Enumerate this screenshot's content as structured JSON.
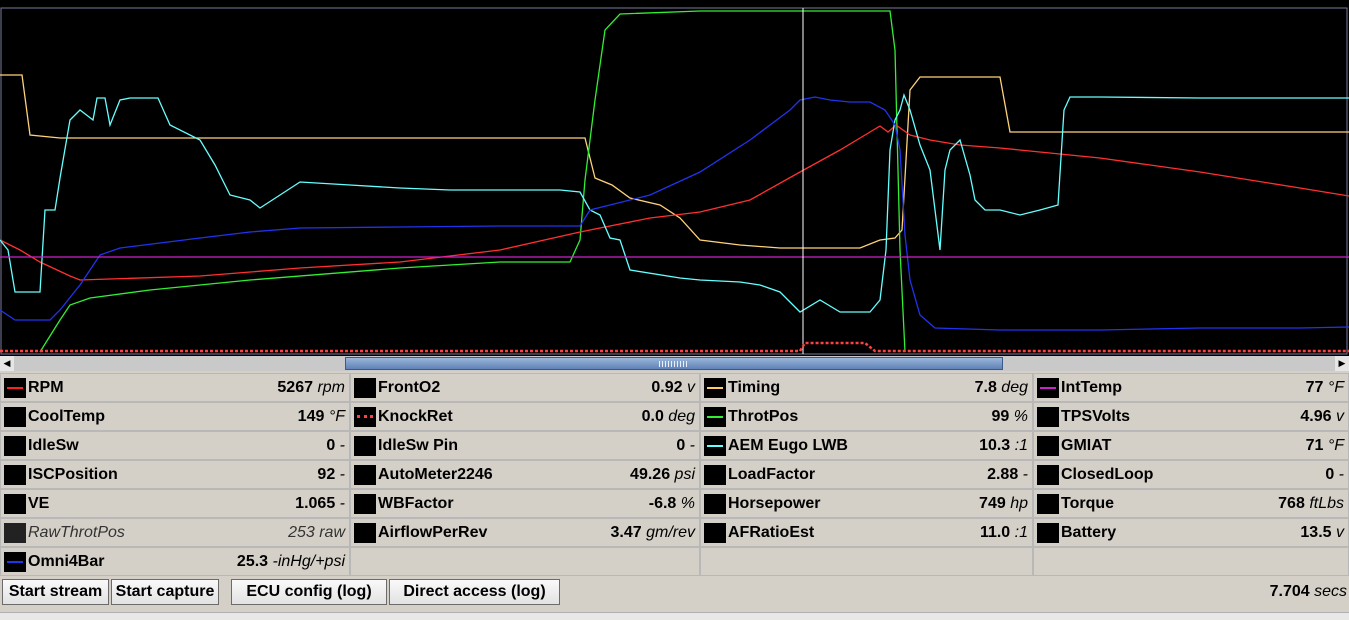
{
  "plot": {
    "series": [
      {
        "name": "Timing",
        "color": "#ffd27a",
        "points": [
          [
            0,
            75
          ],
          [
            22,
            75
          ],
          [
            30,
            135
          ],
          [
            60,
            138
          ],
          [
            100,
            138
          ],
          [
            200,
            138
          ],
          [
            300,
            138
          ],
          [
            400,
            138
          ],
          [
            500,
            138
          ],
          [
            585,
            138
          ],
          [
            595,
            178
          ],
          [
            612,
            185
          ],
          [
            630,
            198
          ],
          [
            660,
            205
          ],
          [
            680,
            218
          ],
          [
            700,
            240
          ],
          [
            740,
            245
          ],
          [
            780,
            248
          ],
          [
            820,
            248
          ],
          [
            860,
            248
          ],
          [
            880,
            240
          ],
          [
            895,
            238
          ],
          [
            902,
            230
          ],
          [
            910,
            90
          ],
          [
            920,
            77
          ],
          [
            1000,
            77
          ],
          [
            1010,
            132
          ],
          [
            1100,
            132
          ],
          [
            1200,
            132
          ],
          [
            1349,
            132
          ]
        ]
      },
      {
        "name": "ThrotPos",
        "color": "#33ee33",
        "points": [
          [
            40,
            352
          ],
          [
            60,
            320
          ],
          [
            70,
            305
          ],
          [
            90,
            298
          ],
          [
            150,
            290
          ],
          [
            250,
            280
          ],
          [
            400,
            268
          ],
          [
            500,
            262
          ],
          [
            570,
            262
          ],
          [
            580,
            240
          ],
          [
            585,
            180
          ],
          [
            595,
            100
          ],
          [
            605,
            30
          ],
          [
            620,
            14
          ],
          [
            700,
            11
          ],
          [
            800,
            11
          ],
          [
            890,
            11
          ],
          [
            895,
            50
          ],
          [
            900,
            250
          ],
          [
            905,
            352
          ]
        ]
      },
      {
        "name": "RPM",
        "color": "#ff3030",
        "points": [
          [
            0,
            240
          ],
          [
            20,
            250
          ],
          [
            40,
            262
          ],
          [
            70,
            276
          ],
          [
            80,
            280
          ],
          [
            200,
            276
          ],
          [
            300,
            268
          ],
          [
            400,
            262
          ],
          [
            500,
            250
          ],
          [
            580,
            232
          ],
          [
            650,
            218
          ],
          [
            700,
            212
          ],
          [
            750,
            200
          ],
          [
            800,
            172
          ],
          [
            840,
            150
          ],
          [
            870,
            132
          ],
          [
            880,
            126
          ],
          [
            888,
            132
          ],
          [
            896,
            125
          ],
          [
            910,
            135
          ],
          [
            930,
            140
          ],
          [
            960,
            145
          ],
          [
            1000,
            148
          ],
          [
            1100,
            158
          ],
          [
            1200,
            172
          ],
          [
            1300,
            188
          ],
          [
            1349,
            196
          ]
        ]
      },
      {
        "name": "AEM Eugo LWB",
        "color": "#66ffff",
        "points": [
          [
            0,
            240
          ],
          [
            8,
            250
          ],
          [
            15,
            292
          ],
          [
            40,
            292
          ],
          [
            45,
            210
          ],
          [
            55,
            210
          ],
          [
            60,
            178
          ],
          [
            70,
            120
          ],
          [
            80,
            110
          ],
          [
            93,
            120
          ],
          [
            97,
            98
          ],
          [
            105,
            98
          ],
          [
            110,
            125
          ],
          [
            120,
            100
          ],
          [
            130,
            98
          ],
          [
            158,
            98
          ],
          [
            170,
            125
          ],
          [
            200,
            140
          ],
          [
            215,
            165
          ],
          [
            230,
            195
          ],
          [
            250,
            200
          ],
          [
            260,
            208
          ],
          [
            300,
            182
          ],
          [
            350,
            185
          ],
          [
            400,
            188
          ],
          [
            450,
            190
          ],
          [
            500,
            190
          ],
          [
            560,
            190
          ],
          [
            580,
            192
          ],
          [
            590,
            210
          ],
          [
            600,
            215
          ],
          [
            610,
            238
          ],
          [
            620,
            240
          ],
          [
            630,
            270
          ],
          [
            680,
            278
          ],
          [
            700,
            280
          ],
          [
            740,
            282
          ],
          [
            760,
            285
          ],
          [
            780,
            292
          ],
          [
            800,
            312
          ],
          [
            820,
            300
          ],
          [
            840,
            312
          ],
          [
            870,
            312
          ],
          [
            880,
            300
          ],
          [
            886,
            250
          ],
          [
            890,
            150
          ],
          [
            895,
            120
          ],
          [
            900,
            110
          ],
          [
            904,
            95
          ],
          [
            910,
            110
          ],
          [
            920,
            145
          ],
          [
            930,
            170
          ],
          [
            940,
            250
          ],
          [
            945,
            170
          ],
          [
            950,
            150
          ],
          [
            960,
            140
          ],
          [
            970,
            175
          ],
          [
            975,
            200
          ],
          [
            985,
            210
          ],
          [
            1000,
            210
          ],
          [
            1020,
            215
          ],
          [
            1040,
            210
          ],
          [
            1058,
            205
          ],
          [
            1064,
            110
          ],
          [
            1070,
            97
          ],
          [
            1100,
            97
          ],
          [
            1200,
            98
          ],
          [
            1349,
            98
          ]
        ]
      },
      {
        "name": "Omni4Bar",
        "color": "#2233ee",
        "points": [
          [
            0,
            310
          ],
          [
            15,
            320
          ],
          [
            50,
            320
          ],
          [
            60,
            310
          ],
          [
            80,
            285
          ],
          [
            90,
            270
          ],
          [
            100,
            255
          ],
          [
            120,
            248
          ],
          [
            200,
            238
          ],
          [
            250,
            232
          ],
          [
            300,
            228
          ],
          [
            400,
            227
          ],
          [
            500,
            226
          ],
          [
            580,
            226
          ],
          [
            590,
            210
          ],
          [
            650,
            195
          ],
          [
            700,
            172
          ],
          [
            750,
            140
          ],
          [
            790,
            110
          ],
          [
            800,
            100
          ],
          [
            815,
            97
          ],
          [
            830,
            100
          ],
          [
            850,
            102
          ],
          [
            870,
            102
          ],
          [
            885,
            110
          ],
          [
            895,
            125
          ],
          [
            900,
            150
          ],
          [
            905,
            235
          ],
          [
            910,
            280
          ],
          [
            920,
            315
          ],
          [
            935,
            328
          ],
          [
            1000,
            330
          ],
          [
            1100,
            330
          ],
          [
            1200,
            328
          ],
          [
            1300,
            328
          ],
          [
            1349,
            327
          ]
        ]
      },
      {
        "name": "IntTemp",
        "color": "#cc22cc",
        "points": [
          [
            0,
            257
          ],
          [
            1349,
            257
          ]
        ]
      }
    ],
    "knock": {
      "name": "KnockRet",
      "color": "#ff4040",
      "points": [
        [
          0,
          351
        ],
        [
          800,
          351
        ],
        [
          805,
          343
        ],
        [
          865,
          343
        ],
        [
          875,
          351
        ],
        [
          1349,
          351
        ]
      ]
    }
  },
  "cells": [
    {
      "name": "RPM",
      "value": "5267",
      "unit": "rpm",
      "color": "#ff2020"
    },
    {
      "name": "FrontO2",
      "value": "0.92",
      "unit": "v"
    },
    {
      "name": "Timing",
      "value": "7.8",
      "unit": "deg",
      "color": "#ffcc66"
    },
    {
      "name": "IntTemp",
      "value": "77",
      "unit": "°F",
      "color": "#cc22cc"
    },
    {
      "name": "CoolTemp",
      "value": "149",
      "unit": "°F"
    },
    {
      "name": "KnockRet",
      "value": "0.0",
      "unit": "deg",
      "color": "#ff4040",
      "dotted": true
    },
    {
      "name": "ThrotPos",
      "value": "99",
      "unit": "%",
      "color": "#33ee33"
    },
    {
      "name": "TPSVolts",
      "value": "4.96",
      "unit": "v"
    },
    {
      "name": "IdleSw",
      "value": "0",
      "unit": "-"
    },
    {
      "name": "IdleSw Pin",
      "value": "0",
      "unit": "-"
    },
    {
      "name": "AEM Eugo LWB",
      "value": "10.3",
      "unit": ":1",
      "color": "#66ffff"
    },
    {
      "name": "GMIAT",
      "value": "71",
      "unit": "°F"
    },
    {
      "name": "ISCPosition",
      "value": "92",
      "unit": "-"
    },
    {
      "name": "AutoMeter2246",
      "value": "49.26",
      "unit": "psi"
    },
    {
      "name": "LoadFactor",
      "value": "2.88",
      "unit": "-"
    },
    {
      "name": "ClosedLoop",
      "value": "0",
      "unit": "-"
    },
    {
      "name": "VE",
      "value": "1.065",
      "unit": "-"
    },
    {
      "name": "WBFactor",
      "value": "-6.8",
      "unit": "%"
    },
    {
      "name": "Horsepower",
      "value": "749",
      "unit": "hp"
    },
    {
      "name": "Torque",
      "value": "768",
      "unit": "ftLbs"
    },
    {
      "name": "RawThrotPos",
      "value": "253",
      "unit": "raw",
      "dim": true
    },
    {
      "name": "AirflowPerRev",
      "value": "3.47",
      "unit": "gm/rev"
    },
    {
      "name": "AFRatioEst",
      "value": "11.0",
      "unit": ":1"
    },
    {
      "name": "Battery",
      "value": "13.5",
      "unit": "v"
    },
    {
      "name": "Omni4Bar",
      "value": "25.3",
      "unit": "-inHg/+psi",
      "color": "#2233ee"
    }
  ],
  "buttons": {
    "start_stream": "Start stream",
    "start_capture": "Start capture",
    "ecu_config": "ECU config (log)",
    "direct_access": "Direct access (log)"
  },
  "status": {
    "time_value": "7.704",
    "time_unit": "secs"
  },
  "scroll": {
    "left_arrow": "◀",
    "right_arrow": "▶"
  }
}
